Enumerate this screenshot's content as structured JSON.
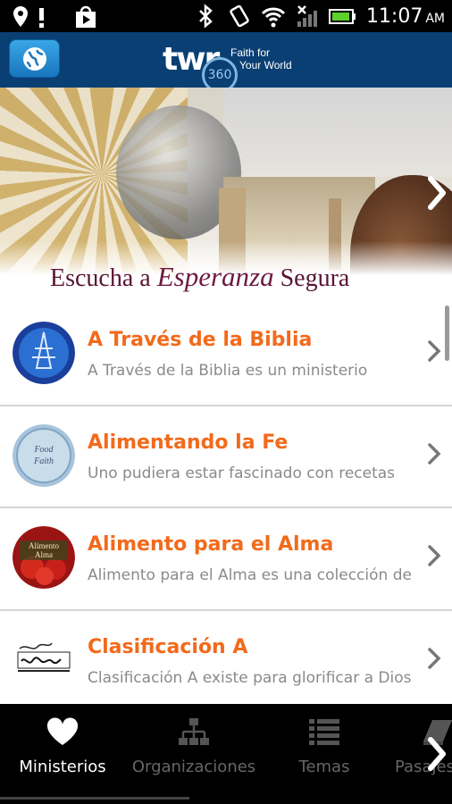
{
  "status_bar": {
    "time": "11:07",
    "ampm": "AM",
    "icons": [
      "location-icon",
      "alert-icon",
      "play-store-icon",
      "bluetooth-icon",
      "vibrate-icon",
      "wifi-icon",
      "signal-icon",
      "battery-icon"
    ]
  },
  "header": {
    "logo_text": "twr",
    "logo_badge": "360",
    "tagline_line1": "Faith for",
    "tagline_line2": "Your World",
    "colors": {
      "bar": "#0a3f74",
      "button": "#2a8fd6"
    }
  },
  "banner": {
    "caption_pre": "Escucha a",
    "caption_em": "Esperanza",
    "caption_post": "Segura"
  },
  "list": {
    "items": [
      {
        "title": "A Través de la Biblia",
        "subtitle": "A Través de la Biblia es un ministerio",
        "thumb_icon": "globe-tower-icon"
      },
      {
        "title": "Alimentando la Fe",
        "subtitle": "Uno pudiera estar fascinado con recetas",
        "thumb_icon": "food-for-faith-icon"
      },
      {
        "title": "Alimento para el Alma",
        "subtitle": "Alimento para el Alma es una colección de",
        "thumb_icon": "strawberries-icon"
      },
      {
        "title": "Clasificación A",
        "subtitle": "Clasificación A existe para glorificar a Dios",
        "thumb_icon": "clasificacion-logo-icon"
      }
    ],
    "accent_color": "#f26a1b"
  },
  "tabs": [
    {
      "label": "Ministerios",
      "icon": "heart-icon",
      "active": true
    },
    {
      "label": "Organizaciones",
      "icon": "org-chart-icon",
      "active": false
    },
    {
      "label": "Temas",
      "icon": "list-icon",
      "active": false
    },
    {
      "label": "Pasajes",
      "icon": "book-icon",
      "active": false
    }
  ]
}
